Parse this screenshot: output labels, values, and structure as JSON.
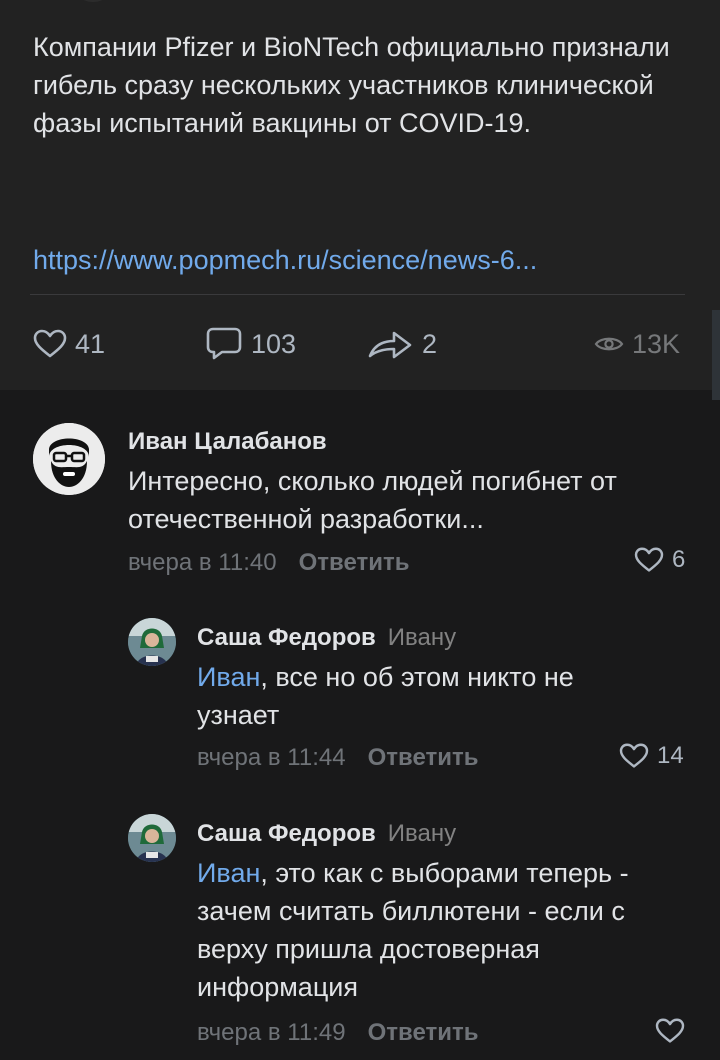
{
  "post": {
    "text": "Компании Pfizer и BioNTech официально признали гибель сразу нескольких участников клинической фазы испытаний вакцины от COVID-19.",
    "link": "https://www.popmech.ru/science/news-6...",
    "likes": "41",
    "comments": "103",
    "shares": "2",
    "views": "13K"
  },
  "comments": [
    {
      "author": "Иван Цалабанов",
      "text": "Интересно, сколько людей погибнет от отечественной разработки...",
      "time": "вчера в 11:40",
      "reply_label": "Ответить",
      "likes": "6"
    },
    {
      "author": "Саша Федоров",
      "reply_to": "Ивану",
      "mention": "Иван",
      "text": ", все но об этом никто не узнает",
      "time": "вчера в 11:44",
      "reply_label": "Ответить",
      "likes": "14"
    },
    {
      "author": "Саша Федоров",
      "reply_to": "Ивану",
      "mention": "Иван",
      "text": ", это как с выборами теперь - зачем считать биллютени - если с верху пришла достоверная информация",
      "time": "вчера в 11:49",
      "reply_label": "Ответить",
      "likes": ""
    }
  ],
  "icons": {
    "like": "heart-icon",
    "comment": "comment-bubble-icon",
    "share": "share-arrow-icon",
    "views": "eye-icon"
  },
  "colors": {
    "background": "#19191a",
    "post_background": "#222222",
    "link": "#71aaeb",
    "text": "#e1e3e6",
    "muted": "#6f7378"
  }
}
